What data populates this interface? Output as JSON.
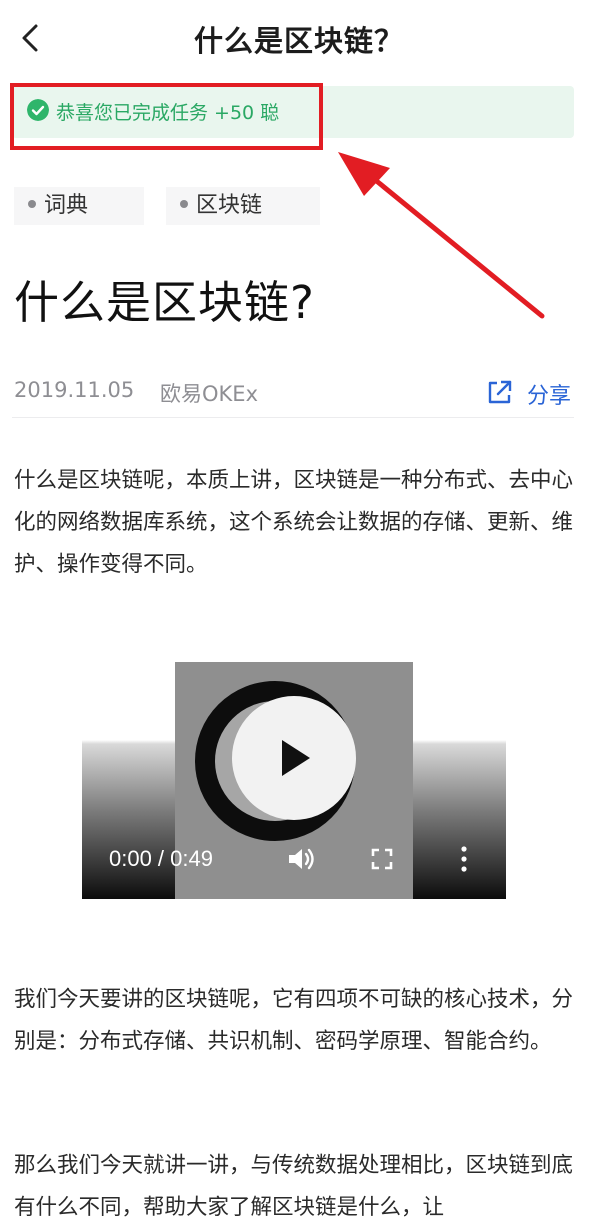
{
  "header": {
    "title": "什么是区块链？"
  },
  "task_banner": {
    "text": "恭喜您已完成任务 +50 聪"
  },
  "tags": [
    "词典",
    "区块链"
  ],
  "article": {
    "title": "什么是区块链?",
    "date": "2019.11.05",
    "author": "欧易OKEx",
    "share_label": "分享",
    "paragraphs": [
      "什么是区块链呢，本质上讲，区块链是一种分布式、去中心化的网络数据库系统，这个系统会让数据的存储、更新、维护、操作变得不同。",
      "我们今天要讲的区块链呢，它有四项不可缺的核心技术，分别是：分布式存储、共识机制、密码学原理、智能合约。",
      "那么我们今天就讲一讲，与传统数据处理相比，区块链到底有什么不同，帮助大家了解区块链是什么，让"
    ]
  },
  "video": {
    "time_display": "0:00 / 0:49"
  },
  "colors": {
    "accent_green": "#2fb56b",
    "link_blue": "#2a64d6",
    "annotation_red": "#e21d23"
  },
  "icons": [
    "back-chevron-icon",
    "check-circle-icon",
    "share-icon",
    "play-icon",
    "volume-icon",
    "fullscreen-icon",
    "more-vertical-icon",
    "red-arrow-annotation"
  ]
}
